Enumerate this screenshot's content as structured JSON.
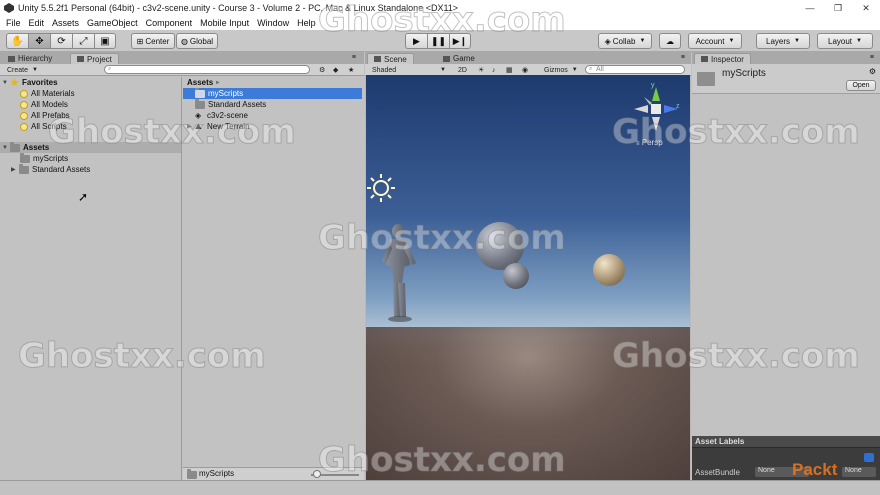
{
  "window": {
    "title": "Unity 5.5.2f1 Personal (64bit) - c3v2-scene.unity - Course 3 - Volume 2 - PC, Mac & Linux Standalone <DX11>",
    "minimize": "—",
    "maximize": "❐",
    "close": "✕"
  },
  "menu": [
    "File",
    "Edit",
    "Assets",
    "GameObject",
    "Component",
    "Mobile Input",
    "Window",
    "Help"
  ],
  "toolbar": {
    "center": "Center",
    "global": "Global",
    "collab": "Collab",
    "account": "Account",
    "layers": "Layers",
    "layout": "Layout"
  },
  "tabs": {
    "hierarchy": "Hierarchy",
    "project": "Project",
    "scene": "Scene",
    "game": "Game",
    "inspector": "Inspector"
  },
  "project": {
    "create": "Create",
    "favorites_label": "Favorites",
    "favorites": [
      "All Materials",
      "All Models",
      "All Prefabs",
      "All Scripts"
    ],
    "assets_label": "Assets",
    "assets_tree": [
      "myScripts",
      "Standard Assets"
    ],
    "breadcrumb": "Assets",
    "breadcrumb_arrow": "▸",
    "list": [
      "myScripts",
      "Standard Assets",
      "c3v2-scene",
      "New Terrain"
    ],
    "status_path": "myScripts"
  },
  "scene": {
    "shading": "Shaded",
    "mode_2d": "2D",
    "gizmos": "Gizmos",
    "search_placeholder": "All",
    "persp": "Persp",
    "axis_y": "y",
    "axis_z": "z"
  },
  "inspector": {
    "name": "myScripts",
    "open": "Open",
    "asset_labels": "Asset Labels",
    "asset_bundle": "AssetBundle",
    "bundle_value": "None",
    "variant_value": "None"
  },
  "watermark": "Ghostxx.com",
  "logo": "Packt",
  "colors": {
    "selection": "#3d7bd8",
    "panel_bg": "#c2c2c2"
  }
}
